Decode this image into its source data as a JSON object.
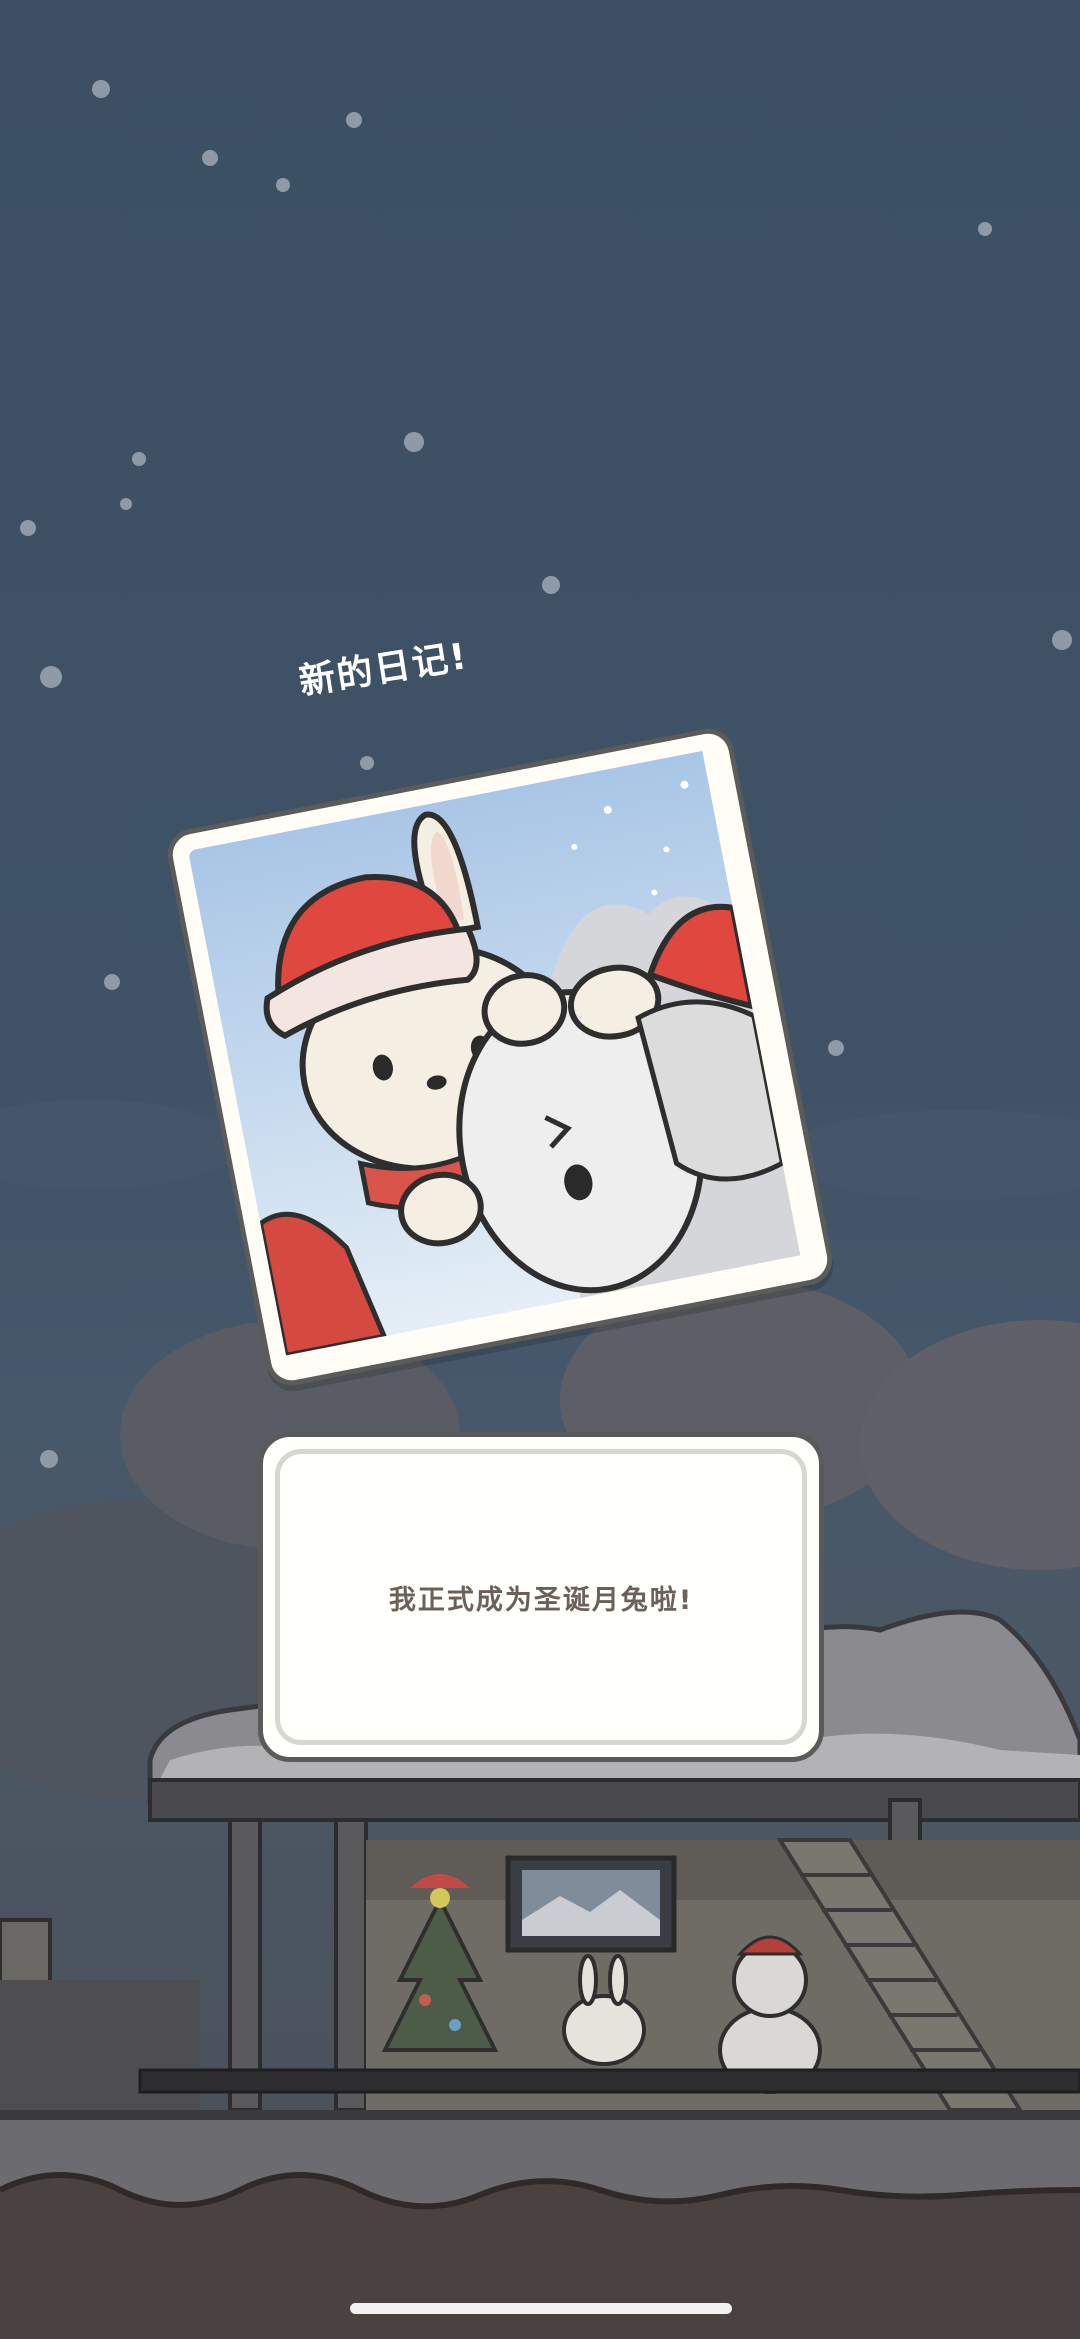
{
  "diary": {
    "title": "新的日记!",
    "message": "我正式成为圣诞月兔啦!"
  },
  "colors": {
    "sky": "#3f5266",
    "card_bg": "#fffffb",
    "text": "#6b6158",
    "hat_red": "#e0483f"
  },
  "icons": [
    "rabbit-santa-hat-illustration",
    "snowman-illustration",
    "christmas-tree-icon",
    "house-illustration"
  ]
}
